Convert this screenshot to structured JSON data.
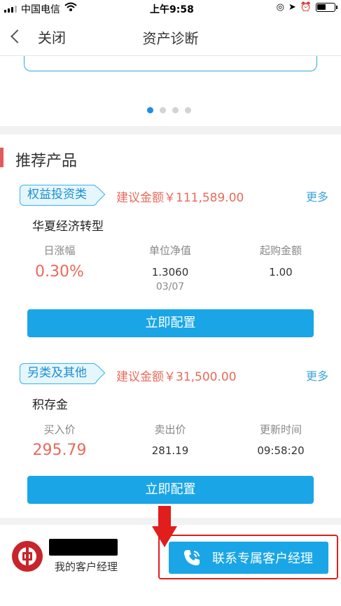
{
  "status": {
    "carrier": "中国电信",
    "time": "上午9:58"
  },
  "nav": {
    "back_label": "关闭",
    "title": "资产诊断"
  },
  "carousel": {
    "page_count": 4,
    "active_index": 0
  },
  "section": {
    "title": "推荐产品"
  },
  "products": [
    {
      "category": "权益投资类",
      "suggest": "建议金额￥111,589.00",
      "more": "更多",
      "name": "华夏经济转型",
      "cols": [
        {
          "label": "日涨幅",
          "value": "0.30%"
        },
        {
          "label": "单位净值",
          "value": "1.3060",
          "sub": "03/07"
        },
        {
          "label": "起购金额",
          "value": "1.00"
        }
      ],
      "button": "立即配置"
    },
    {
      "category": "另类及其他",
      "suggest": "建议金额￥31,500.00",
      "more": "更多",
      "name": "积存金",
      "cols": [
        {
          "label": "买入价",
          "value": "295.79"
        },
        {
          "label": "卖出价",
          "value": "281.19"
        },
        {
          "label": "更新时间",
          "value": "09:58:20"
        }
      ],
      "button": "立即配置"
    }
  ],
  "footer": {
    "manager_label": "我的客户经理",
    "contact_button": "联系专属客户经理"
  }
}
